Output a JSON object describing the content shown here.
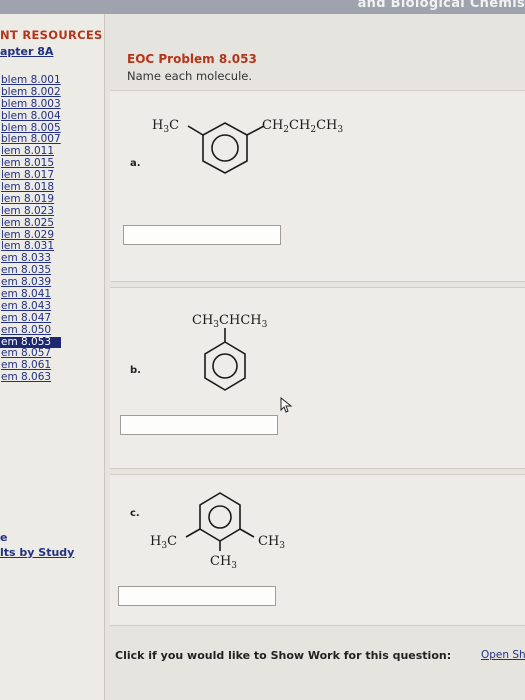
{
  "header": {
    "course_title": "and Biological Chemis"
  },
  "sidebar": {
    "heading": "NT RESOURCES",
    "chapter": "apter 8A",
    "items": [
      "blem 8.001",
      "blem 8.002",
      "blem 8.003",
      "blem 8.004",
      "blem 8.005",
      "blem 8.007",
      "lem 8.011",
      "lem 8.015",
      "lem 8.017",
      "lem 8.018",
      "lem 8.019",
      "lem 8.023",
      "lem 8.025",
      "lem 8.029",
      "lem 8.031",
      "em 8.033",
      "em 8.035",
      "em 8.039",
      "em 8.041",
      "em 8.043",
      "em 8.047",
      "em 8.050",
      "em 8.053",
      "em 8.057",
      "em 8.061",
      "em 8.063"
    ],
    "active_index": 22,
    "footer_e": "e",
    "results_link": "lts by Study"
  },
  "problem": {
    "title": "EOC Problem 8.053",
    "instruction": "Name each molecule.",
    "parts": [
      {
        "letter": "a.",
        "answer_value": "",
        "sub1": "H",
        "sub1_sub": "3",
        "sub1_end": "C",
        "sub2": "CH",
        "sub2_a": "2",
        "sub2_b": "CH",
        "sub2_c": "2",
        "sub2_d": "CH",
        "sub2_e": "3"
      },
      {
        "letter": "b.",
        "answer_value": "",
        "top1": "CH",
        "top1_sub": "3",
        "top1_mid": "CHCH",
        "top1_sub2": "3"
      },
      {
        "letter": "c.",
        "answer_value": "",
        "left1": "H",
        "left1_sub": "3",
        "left1_end": "C",
        "right1": "CH",
        "right1_sub": "3",
        "bottom1": "CH",
        "bottom1_sub": "3"
      }
    ]
  },
  "footer": {
    "show_work_prompt": "Click if you would like to Show Work for this question:",
    "open_link": "Open Sh"
  }
}
